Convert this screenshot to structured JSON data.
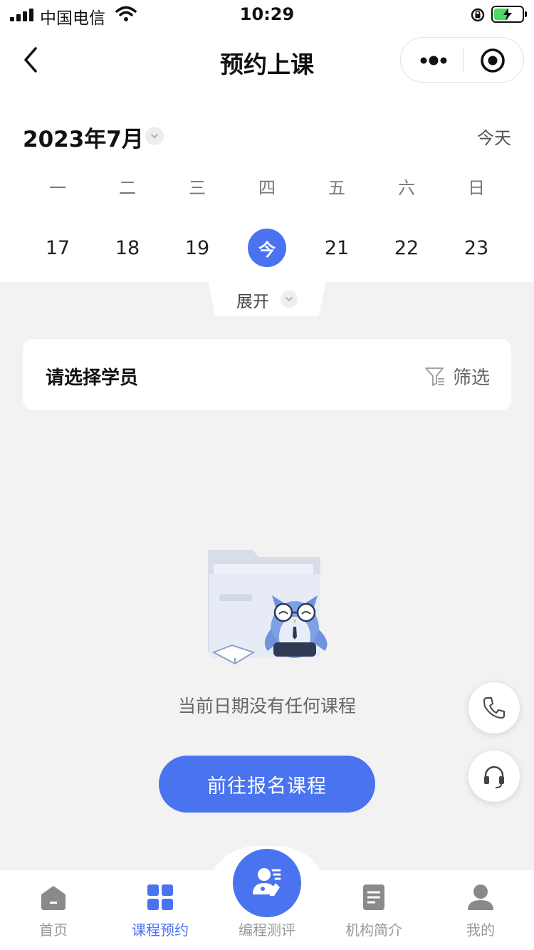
{
  "status_bar": {
    "carrier": "中国电信",
    "time": "10:29"
  },
  "nav": {
    "title": "预约上课",
    "icons": [
      "back-arrow-icon",
      "more-dots-icon",
      "target-close-icon"
    ]
  },
  "calendar": {
    "month": "2023年7月",
    "today_link": "今天",
    "weekdays": [
      "一",
      "二",
      "三",
      "四",
      "五",
      "六",
      "日"
    ],
    "dates": [
      "17",
      "18",
      "19",
      "今",
      "21",
      "22",
      "23"
    ],
    "selected_index": 3,
    "expand_label": "展开"
  },
  "student_filter": {
    "label": "请选择学员",
    "filter_label": "筛选"
  },
  "empty_state": {
    "message": "当前日期没有任何课程",
    "cta": "前往报名课程"
  },
  "floating_buttons": [
    "phone-icon",
    "headset-icon"
  ],
  "tab_bar": {
    "items": [
      {
        "label": "首页",
        "icon": "home-icon",
        "active": false
      },
      {
        "label": "课程预约",
        "icon": "grid-icon",
        "active": true
      },
      {
        "label": "编程测评",
        "icon": "assessment-icon",
        "active": false
      },
      {
        "label": "机构简介",
        "icon": "document-icon",
        "active": false
      },
      {
        "label": "我的",
        "icon": "profile-icon",
        "active": false
      }
    ]
  },
  "colors": {
    "accent": "#4a73f0",
    "background": "#f2f2f2",
    "battery": "#4cd964"
  }
}
